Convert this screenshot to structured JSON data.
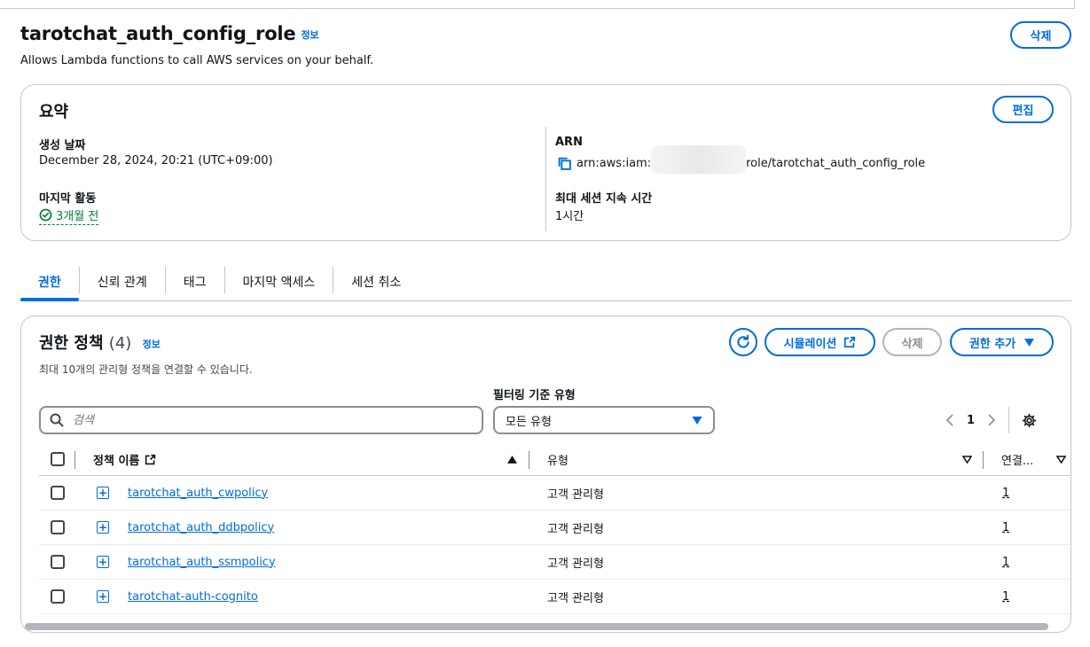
{
  "header": {
    "title": "tarotchat_auth_config_role",
    "info": "정보",
    "description": "Allows Lambda functions to call AWS services on your behalf.",
    "delete_label": "삭제"
  },
  "summary": {
    "title": "요약",
    "edit_label": "편집",
    "created_label": "생성 날짜",
    "created_value": "December 28, 2024, 20:21 (UTC+09:00)",
    "last_activity_label": "마지막 활동",
    "last_activity_value": "3개월 전",
    "arn_label": "ARN",
    "arn_prefix": "arn:aws:iam:",
    "arn_suffix": "role/tarotchat_auth_config_role",
    "max_session_label": "최대 세션 지속 시간",
    "max_session_value": "1시간"
  },
  "tabs": [
    {
      "label": "권한"
    },
    {
      "label": "신뢰 관계"
    },
    {
      "label": "태그"
    },
    {
      "label": "마지막 액세스"
    },
    {
      "label": "세션 취소"
    }
  ],
  "policies": {
    "title": "권한 정책",
    "count": "(4)",
    "info": "정보",
    "description": "최대 10개의 관리형 정책을 연결할 수 있습니다.",
    "simulate_label": "시뮬레이션",
    "delete_label": "삭제",
    "add_label": "권한 추가",
    "filter_label": "필터링 기준 유형",
    "search_placeholder": "검색",
    "filter_value": "모든 유형",
    "page": "1",
    "columns": {
      "name": "정책 이름",
      "type": "유형",
      "attached": "연결..."
    },
    "rows": [
      {
        "name": "tarotchat_auth_cwpolicy",
        "type": "고객 관리형",
        "attached": "1"
      },
      {
        "name": "tarotchat_auth_ddbpolicy",
        "type": "고객 관리형",
        "attached": "1"
      },
      {
        "name": "tarotchat_auth_ssmpolicy",
        "type": "고객 관리형",
        "attached": "1"
      },
      {
        "name": "tarotchat-auth-cognito",
        "type": "고객 관리형",
        "attached": "1"
      }
    ]
  },
  "colors": {
    "accent": "#006ce0",
    "success": "#00802f",
    "border": "#c6c6cd"
  }
}
